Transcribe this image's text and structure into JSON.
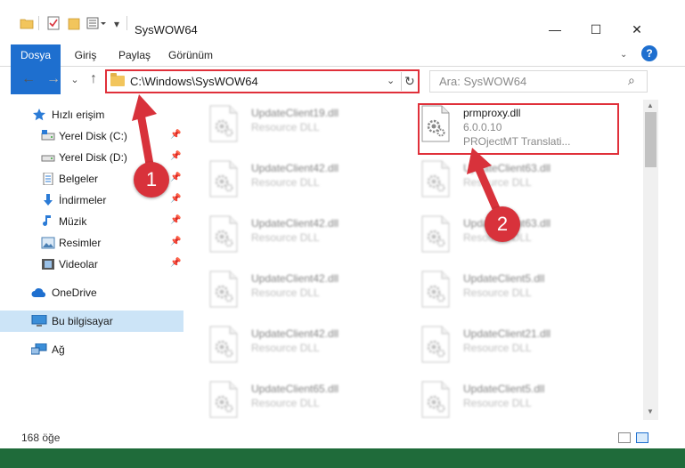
{
  "window": {
    "title": "SysWOW64",
    "minimize": "—",
    "maximize": "☐",
    "close": "✕"
  },
  "ribbon": {
    "tabs": [
      "Dosya",
      "Giriş",
      "Paylaş",
      "Görünüm"
    ],
    "help": "?",
    "collapse": "⌄"
  },
  "address": {
    "path": "C:\\Windows\\SysWOW64",
    "dropdown": "⌄",
    "refresh": "↻",
    "search_placeholder": "Ara: SysWOW64",
    "search_icon": "⌕"
  },
  "nav_buttons": {
    "back": "←",
    "forward": "→",
    "recent": "⌄",
    "up": "↑"
  },
  "sidebar": {
    "items": [
      {
        "label": "Hızlı erişim",
        "icon": "star-icon"
      },
      {
        "label": "Yerel Disk (C:)",
        "icon": "drive-icon",
        "pinned": true
      },
      {
        "label": "Yerel Disk (D:)",
        "icon": "drive-icon",
        "pinned": true
      },
      {
        "label": "Belgeler",
        "icon": "documents-icon",
        "pinned": true
      },
      {
        "label": "İndirmeler",
        "icon": "download-icon",
        "pinned": true
      },
      {
        "label": "Müzik",
        "icon": "music-icon",
        "pinned": true
      },
      {
        "label": "Resimler",
        "icon": "pictures-icon",
        "pinned": true
      },
      {
        "label": "Videolar",
        "icon": "videos-icon",
        "pinned": true
      },
      {
        "label": "OneDrive",
        "icon": "onedrive-icon"
      },
      {
        "label": "Bu bilgisayar",
        "icon": "computer-icon",
        "selected": true
      },
      {
        "label": "Ağ",
        "icon": "network-icon"
      }
    ],
    "pin_glyph": "📌"
  },
  "files": {
    "left_column": [
      {
        "name": "UpdateClient19.dll",
        "type": "Resource DLL"
      },
      {
        "name": "UpdateClient42.dll",
        "type": "Resource DLL"
      },
      {
        "name": "UpdateClient42.dll",
        "type": "Resource DLL"
      },
      {
        "name": "UpdateClient42.dll",
        "type": "Resource DLL"
      },
      {
        "name": "UpdateClient42.dll",
        "type": "Resource DLL"
      },
      {
        "name": "UpdateClient65.dll",
        "type": "Resource DLL"
      }
    ],
    "highlighted": {
      "name": "prmproxy.dll",
      "version": "6.0.0.10",
      "description": "PROjectMT Translati..."
    },
    "right_column": [
      {
        "name": "UpdateClient63.dll",
        "type": "Resource DLL"
      },
      {
        "name": "UpdateClient63.dll",
        "type": "Resource DLL"
      },
      {
        "name": "UpdateClient5.dll",
        "type": "Resource DLL"
      },
      {
        "name": "UpdateClient21.dll",
        "type": "Resource DLL"
      },
      {
        "name": "UpdateClient5.dll",
        "type": "Resource DLL"
      }
    ]
  },
  "status": {
    "count": "168 öğe"
  },
  "annotations": {
    "step1": "1",
    "step2": "2"
  },
  "colors": {
    "accent": "#1e6fcf",
    "highlight": "#e0303a",
    "arrow": "#d8323b"
  }
}
